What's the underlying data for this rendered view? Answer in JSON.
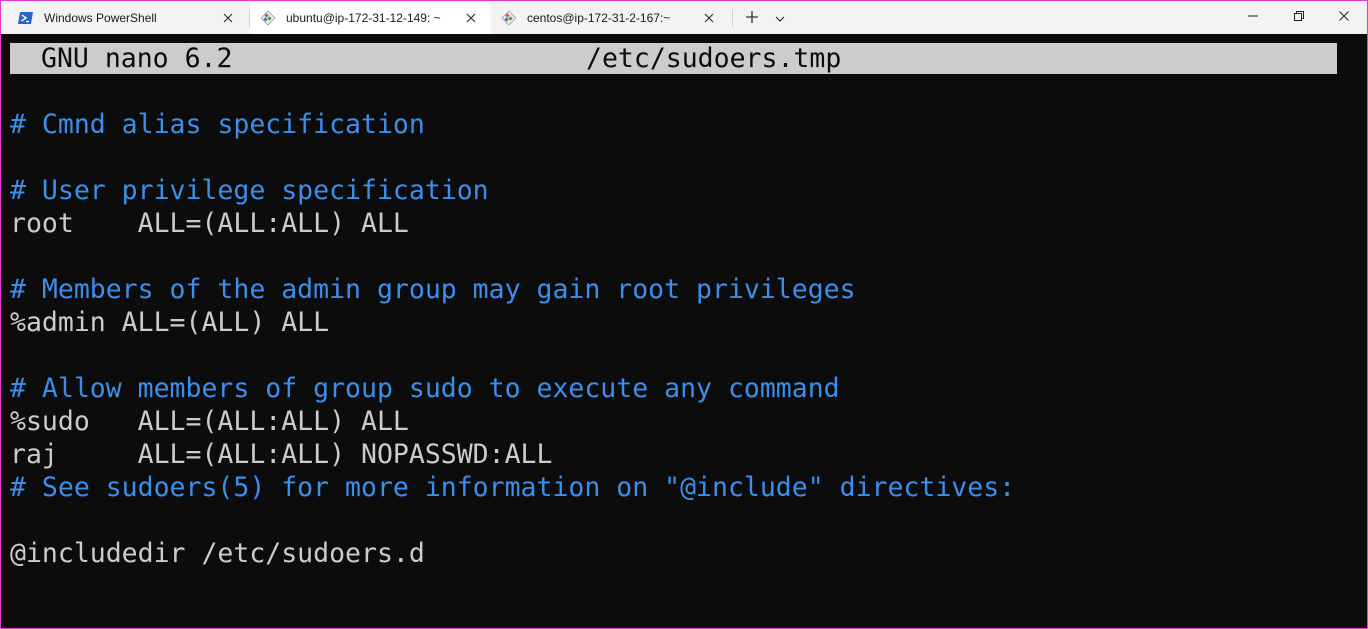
{
  "tabs": [
    {
      "label": "Windows PowerShell",
      "icon": "powershell-icon",
      "active": false
    },
    {
      "label": "ubuntu@ip-172-31-12-149: ~",
      "icon": "linux-shell-icon",
      "active": true
    },
    {
      "label": "centos@ip-172-31-2-167:~",
      "icon": "linux-shell-icon",
      "active": false
    }
  ],
  "tab_controls": {
    "new_tab_icon": "plus-icon",
    "dropdown_icon": "chevron-down-icon"
  },
  "window_controls": [
    "minimize-icon",
    "restore-icon",
    "close-icon"
  ],
  "colors": {
    "comment": "#3b8eea",
    "text": "#cccccc",
    "background": "#0c0c0c",
    "header_bg": "#cccccc",
    "window_border": "#e23ad0"
  },
  "nano": {
    "app": "GNU nano 6.2",
    "filename": "/etc/sudoers.tmp"
  },
  "lines": [
    {
      "text": "# Cmnd alias specification",
      "kind": "comment"
    },
    {
      "text": "# User privilege specification",
      "kind": "comment"
    },
    {
      "text": "root    ALL=(ALL:ALL) ALL",
      "kind": "code"
    },
    {
      "text": "# Members of the admin group may gain root privileges",
      "kind": "comment"
    },
    {
      "text": "%admin ALL=(ALL) ALL",
      "kind": "code"
    },
    {
      "text": "# Allow members of group sudo to execute any command",
      "kind": "comment"
    },
    {
      "text": "%sudo   ALL=(ALL:ALL) ALL",
      "kind": "code"
    },
    {
      "text": "raj     ALL=(ALL:ALL) NOPASSWD:ALL",
      "kind": "code"
    },
    {
      "text": "# See sudoers(5) for more information on \"@include\" directives:",
      "kind": "comment"
    },
    {
      "text": "@includedir /etc/sudoers.d",
      "kind": "code"
    }
  ]
}
